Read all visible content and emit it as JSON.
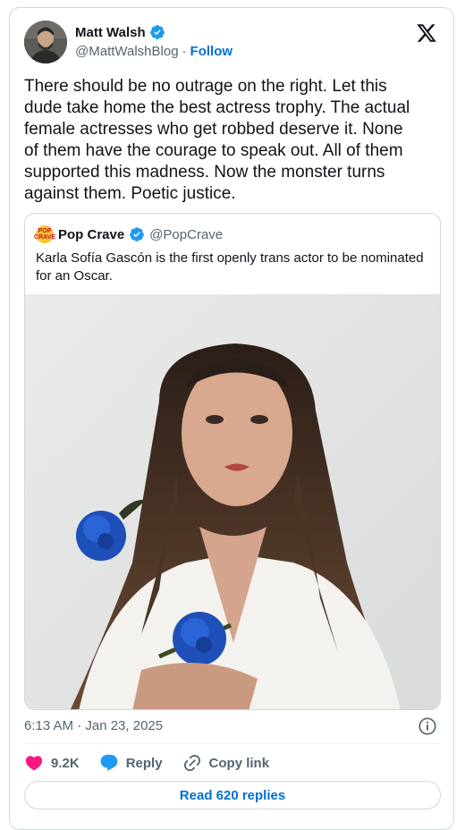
{
  "author": {
    "name": "Matt Walsh",
    "handle": "@MattWalshBlog",
    "separator": "·",
    "follow_label": "Follow"
  },
  "tweet": {
    "text": "There should be no outrage on the right. Let this dude take home the best actress trophy. The actual female actresses who get robbed deserve it. None of them have the courage to speak out. All of them supported this madness. Now the monster turns against them. Poetic justice."
  },
  "quoted_tweet": {
    "name": "Pop Crave",
    "handle": "@PopCrave",
    "avatar_text": "POP CRAVE",
    "text": "Karla Sofía Gascón is the first openly trans actor to be nominated for an Oscar."
  },
  "meta": {
    "timestamp": "6:13 AM · Jan 23, 2025"
  },
  "actions": {
    "likes": "9.2K",
    "reply_label": "Reply",
    "copy_link_label": "Copy link"
  },
  "read_replies_label": "Read 620 replies",
  "colors": {
    "verified_blue": "#1d9bf0",
    "link_blue": "#006fd6",
    "like_red": "#f91880",
    "secondary_text": "#536471",
    "border": "#cfd9de"
  },
  "icons": [
    "verified-badge-icon",
    "x-logo-icon",
    "info-icon",
    "heart-icon",
    "reply-bubble-icon",
    "link-icon"
  ]
}
